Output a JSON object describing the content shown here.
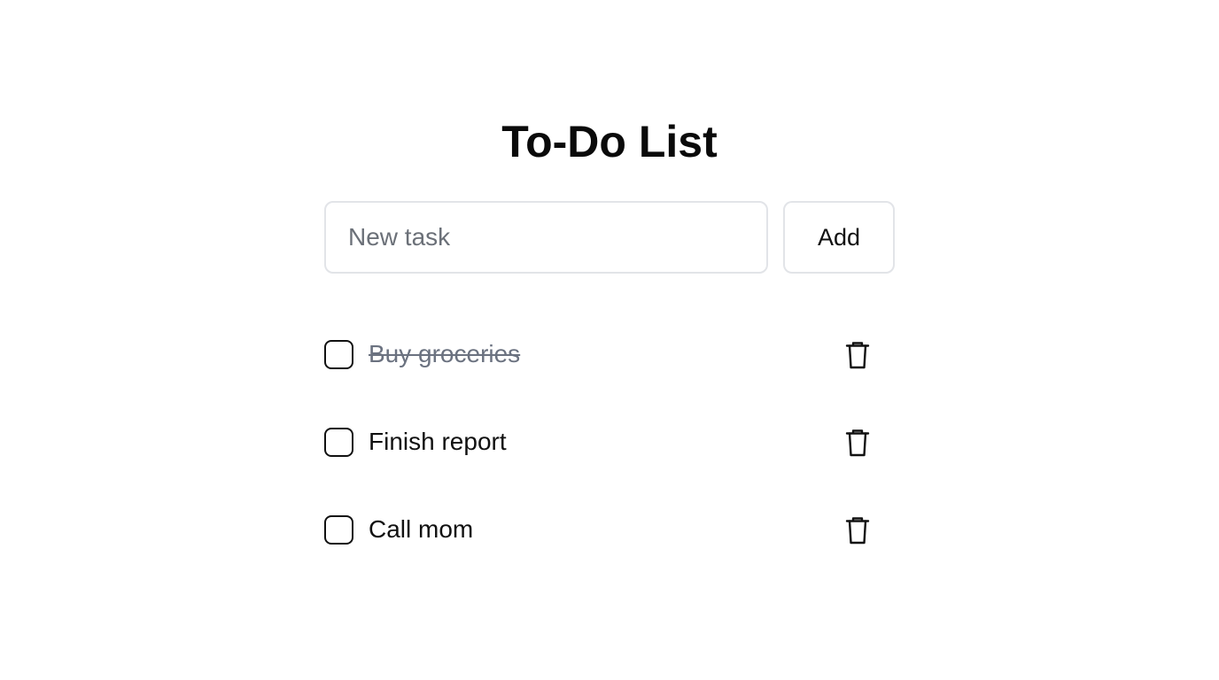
{
  "header": {
    "title": "To-Do List"
  },
  "new_task": {
    "value": "",
    "placeholder": "New task",
    "add_label": "Add"
  },
  "tasks": [
    {
      "label": "Buy groceries",
      "completed": true
    },
    {
      "label": "Finish report",
      "completed": false
    },
    {
      "label": "Call mom",
      "completed": false
    }
  ],
  "icons": {
    "delete": "trash-icon"
  },
  "colors": {
    "completed_text": "#6b7280",
    "border": "#e2e4e8"
  }
}
